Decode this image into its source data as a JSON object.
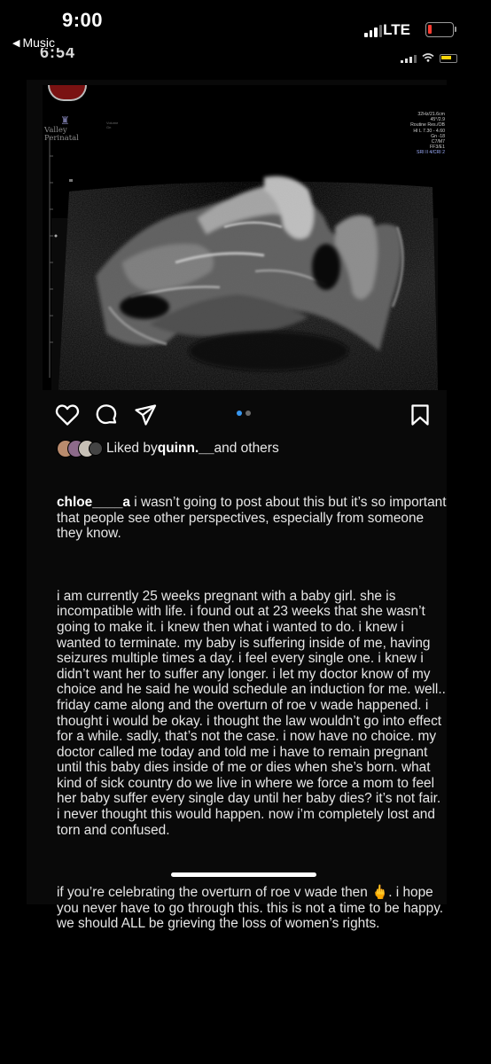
{
  "status_bar": {
    "time": "9:00",
    "back_label": "Music",
    "network": "LTE"
  },
  "underlying_status": {
    "time": "6:54"
  },
  "ultrasound": {
    "logo_line1": "Valley",
    "logo_line2": "Perinatal",
    "params": [
      "32Hz/21.6cm",
      "45°/2.9",
      "Routine Res./OB",
      "HI L  7.30 - 4.60",
      "Gn -18",
      "C7/M7",
      "FF3/E1",
      "SRI II 4/CRI 2"
    ],
    "small_label_1": "Volume",
    "small_label_2": "Gn"
  },
  "actions": {
    "icons": [
      "heart-icon",
      "comment-icon",
      "share-icon",
      "bookmark-icon"
    ],
    "carousel_dots": 2,
    "active_dot": 0,
    "active_color": "#3897f0",
    "inactive_color": "#6b6b6b"
  },
  "likes": {
    "prefix": "Liked by ",
    "user": "quinn.__",
    "suffix": " and others"
  },
  "caption": {
    "username": "chloe____a",
    "intro": " i wasn’t going to post about this but it’s so important that people see other perspectives, especially from someone they know.",
    "paragraph_1": "i am currently 25 weeks pregnant with a baby girl. she is incompatible with life. i found out at 23 weeks that she wasn’t going to make it. i knew then what i wanted to do. i knew i wanted to terminate. my baby is suffering inside of me, having seizures multiple times a day. i feel every single one. i knew i didn’t want her to suffer any longer. i let my doctor know of my choice and he said he would schedule an induction for me. well.. friday came along and the overturn of roe v wade happened. i thought i would be okay. i thought the law wouldn’t go into effect for a while. sadly, that’s not the case. i now have no choice. my doctor called me today and told me i have to remain pregnant until this baby dies inside of me or dies when she’s born. what kind of sick country do we live in where we force a mom to feel her baby suffer every single day until her baby dies? it’s not fair. i never thought this would happen. now i’m completely lost and torn and confused.",
    "paragraph_2_a": "if you’re celebrating the overturn of roe v wade then ",
    "paragraph_2_emoji": "🖕",
    "paragraph_2_b": ". i hope you never have to go through this. this is not a time to be happy. we should ALL be grieving the loss of women’s rights."
  }
}
